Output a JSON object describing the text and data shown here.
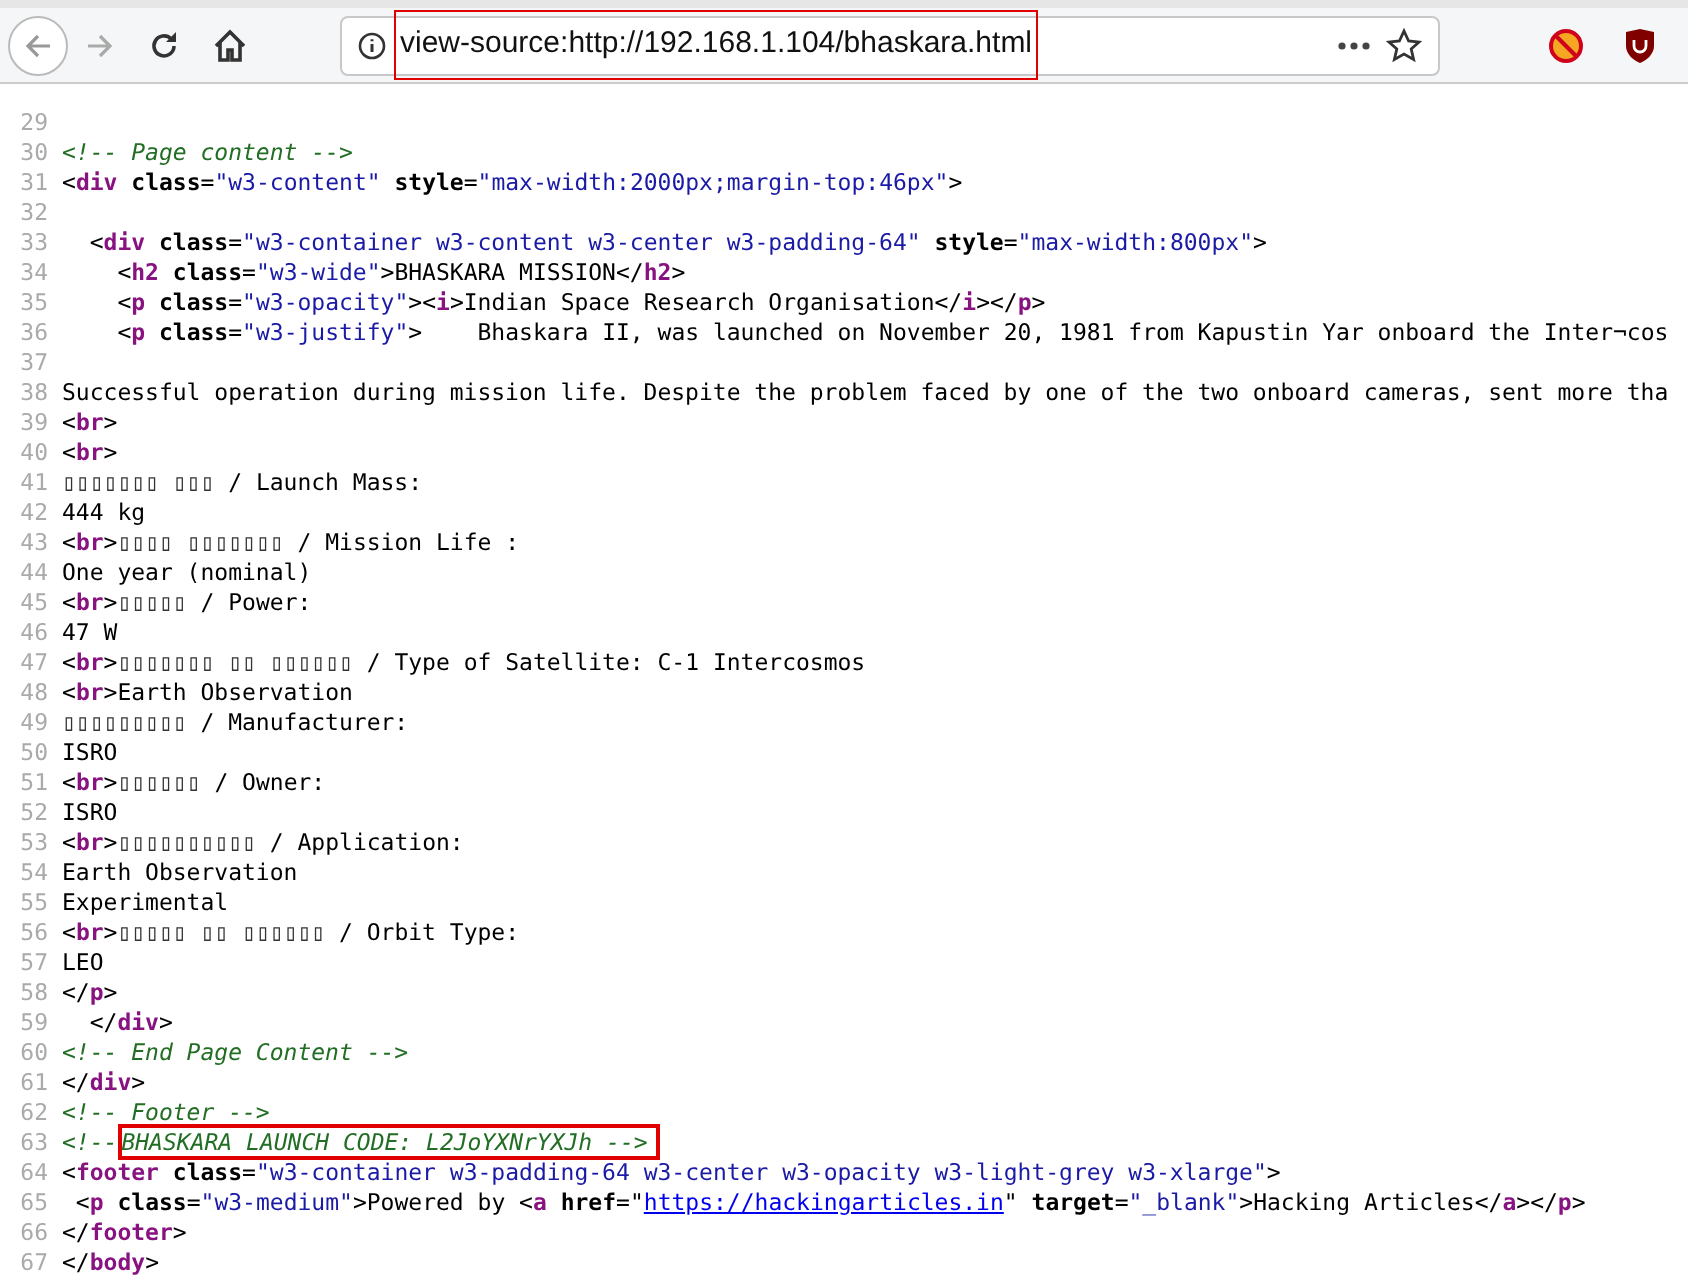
{
  "address_bar": {
    "url": "view-source:http://192.168.1.104/bhaskara.html",
    "annotated": true
  },
  "lines": [
    {
      "number": "29"
    },
    {
      "number": "30",
      "tokens": [
        {
          "kind": "comment",
          "text": "<!-- Page content -->"
        }
      ]
    },
    {
      "number": "31",
      "tokens": [
        {
          "kind": "plain",
          "text": "<"
        },
        {
          "kind": "tag",
          "text": "div"
        },
        {
          "kind": "attr",
          "text": " class"
        },
        {
          "kind": "plain",
          "text": "="
        },
        {
          "kind": "value",
          "text": "\"w3-content\""
        },
        {
          "kind": "attr",
          "text": " style"
        },
        {
          "kind": "plain",
          "text": "="
        },
        {
          "kind": "value",
          "text": "\"max-width:2000px;margin-top:46px\""
        },
        {
          "kind": "plain",
          "text": ">"
        }
      ]
    },
    {
      "number": "32"
    },
    {
      "number": "33",
      "tokens": [
        {
          "kind": "plain",
          "text": "  <"
        },
        {
          "kind": "tag",
          "text": "div"
        },
        {
          "kind": "attr",
          "text": " class"
        },
        {
          "kind": "plain",
          "text": "="
        },
        {
          "kind": "value",
          "text": "\"w3-container w3-content w3-center w3-padding-64\""
        },
        {
          "kind": "attr",
          "text": " style"
        },
        {
          "kind": "plain",
          "text": "="
        },
        {
          "kind": "value",
          "text": "\"max-width:800px\""
        },
        {
          "kind": "plain",
          "text": ">"
        }
      ]
    },
    {
      "number": "34",
      "tokens": [
        {
          "kind": "plain",
          "text": "    <"
        },
        {
          "kind": "tag",
          "text": "h2"
        },
        {
          "kind": "attr",
          "text": " class"
        },
        {
          "kind": "plain",
          "text": "="
        },
        {
          "kind": "value",
          "text": "\"w3-wide\""
        },
        {
          "kind": "plain",
          "text": ">BHASKARA MISSION</"
        },
        {
          "kind": "tag",
          "text": "h2"
        },
        {
          "kind": "plain",
          "text": ">"
        }
      ]
    },
    {
      "number": "35",
      "tokens": [
        {
          "kind": "plain",
          "text": "    <"
        },
        {
          "kind": "tag",
          "text": "p"
        },
        {
          "kind": "attr",
          "text": " class"
        },
        {
          "kind": "plain",
          "text": "="
        },
        {
          "kind": "value",
          "text": "\"w3-opacity\""
        },
        {
          "kind": "plain",
          "text": "><"
        },
        {
          "kind": "tag",
          "text": "i"
        },
        {
          "kind": "plain",
          "text": ">Indian Space Research Organisation</"
        },
        {
          "kind": "tag",
          "text": "i"
        },
        {
          "kind": "plain",
          "text": "></"
        },
        {
          "kind": "tag",
          "text": "p"
        },
        {
          "kind": "plain",
          "text": ">"
        }
      ]
    },
    {
      "number": "36",
      "tokens": [
        {
          "kind": "plain",
          "text": "    <"
        },
        {
          "kind": "tag",
          "text": "p"
        },
        {
          "kind": "attr",
          "text": " class"
        },
        {
          "kind": "plain",
          "text": "="
        },
        {
          "kind": "value",
          "text": "\"w3-justify\""
        },
        {
          "kind": "plain",
          "text": ">    Bhaskara II, was launched on November 20, 1981 from Kapustin Yar onboard the Inter¬cos"
        }
      ]
    },
    {
      "number": "37"
    },
    {
      "number": "38",
      "tokens": [
        {
          "kind": "plain",
          "text": "Successful operation during mission life. Despite the problem faced by one of the two onboard cameras, sent more tha"
        }
      ]
    },
    {
      "number": "39",
      "tokens": [
        {
          "kind": "plain",
          "text": "<"
        },
        {
          "kind": "tag",
          "text": "br"
        },
        {
          "kind": "plain",
          "text": ">"
        }
      ]
    },
    {
      "number": "40",
      "tokens": [
        {
          "kind": "plain",
          "text": "<"
        },
        {
          "kind": "tag",
          "text": "br"
        },
        {
          "kind": "plain",
          "text": ">"
        }
      ]
    },
    {
      "number": "41",
      "tokens": [
        {
          "kind": "missing",
          "text": "▯▯▯▯▯▯▯ ▯▯▯"
        },
        {
          "kind": "plain",
          "text": " / Launch Mass:"
        }
      ]
    },
    {
      "number": "42",
      "tokens": [
        {
          "kind": "plain",
          "text": "444 kg"
        }
      ]
    },
    {
      "number": "43",
      "tokens": [
        {
          "kind": "plain",
          "text": "<"
        },
        {
          "kind": "tag",
          "text": "br"
        },
        {
          "kind": "plain",
          "text": ">"
        },
        {
          "kind": "missing",
          "text": "▯▯▯▯ ▯▯▯▯▯▯▯"
        },
        {
          "kind": "plain",
          "text": " / Mission Life :"
        }
      ]
    },
    {
      "number": "44",
      "tokens": [
        {
          "kind": "plain",
          "text": "One year (nominal)"
        }
      ]
    },
    {
      "number": "45",
      "tokens": [
        {
          "kind": "plain",
          "text": "<"
        },
        {
          "kind": "tag",
          "text": "br"
        },
        {
          "kind": "plain",
          "text": ">"
        },
        {
          "kind": "missing",
          "text": "▯▯▯▯▯"
        },
        {
          "kind": "plain",
          "text": " / Power:"
        }
      ]
    },
    {
      "number": "46",
      "tokens": [
        {
          "kind": "plain",
          "text": "47 W"
        }
      ]
    },
    {
      "number": "47",
      "tokens": [
        {
          "kind": "plain",
          "text": "<"
        },
        {
          "kind": "tag",
          "text": "br"
        },
        {
          "kind": "plain",
          "text": ">"
        },
        {
          "kind": "missing",
          "text": "▯▯▯▯▯▯▯ ▯▯ ▯▯▯▯▯▯"
        },
        {
          "kind": "plain",
          "text": " / Type of Satellite: C-1 Intercosmos"
        }
      ]
    },
    {
      "number": "48",
      "tokens": [
        {
          "kind": "plain",
          "text": "<"
        },
        {
          "kind": "tag",
          "text": "br"
        },
        {
          "kind": "plain",
          "text": ">Earth Observation"
        }
      ]
    },
    {
      "number": "49",
      "tokens": [
        {
          "kind": "missing",
          "text": "▯▯▯▯▯▯▯▯▯"
        },
        {
          "kind": "plain",
          "text": " / Manufacturer:"
        }
      ]
    },
    {
      "number": "50",
      "tokens": [
        {
          "kind": "plain",
          "text": "ISRO"
        }
      ]
    },
    {
      "number": "51",
      "tokens": [
        {
          "kind": "plain",
          "text": "<"
        },
        {
          "kind": "tag",
          "text": "br"
        },
        {
          "kind": "plain",
          "text": ">"
        },
        {
          "kind": "missing",
          "text": "▯▯▯▯▯▯"
        },
        {
          "kind": "plain",
          "text": " / Owner:"
        }
      ]
    },
    {
      "number": "52",
      "tokens": [
        {
          "kind": "plain",
          "text": "ISRO"
        }
      ]
    },
    {
      "number": "53",
      "tokens": [
        {
          "kind": "plain",
          "text": "<"
        },
        {
          "kind": "tag",
          "text": "br"
        },
        {
          "kind": "plain",
          "text": ">"
        },
        {
          "kind": "missing",
          "text": "▯▯▯▯▯▯▯▯▯▯"
        },
        {
          "kind": "plain",
          "text": " / Application:"
        }
      ]
    },
    {
      "number": "54",
      "tokens": [
        {
          "kind": "plain",
          "text": "Earth Observation"
        }
      ]
    },
    {
      "number": "55",
      "tokens": [
        {
          "kind": "plain",
          "text": "Experimental"
        }
      ]
    },
    {
      "number": "56",
      "tokens": [
        {
          "kind": "plain",
          "text": "<"
        },
        {
          "kind": "tag",
          "text": "br"
        },
        {
          "kind": "plain",
          "text": ">"
        },
        {
          "kind": "missing",
          "text": "▯▯▯▯▯ ▯▯ ▯▯▯▯▯▯"
        },
        {
          "kind": "plain",
          "text": " / Orbit Type:"
        }
      ]
    },
    {
      "number": "57",
      "tokens": [
        {
          "kind": "plain",
          "text": "LEO"
        }
      ]
    },
    {
      "number": "58",
      "tokens": [
        {
          "kind": "plain",
          "text": "</"
        },
        {
          "kind": "tag",
          "text": "p"
        },
        {
          "kind": "plain",
          "text": ">"
        }
      ]
    },
    {
      "number": "59",
      "tokens": [
        {
          "kind": "plain",
          "text": "  </"
        },
        {
          "kind": "tag",
          "text": "div"
        },
        {
          "kind": "plain",
          "text": ">"
        }
      ]
    },
    {
      "number": "60",
      "tokens": [
        {
          "kind": "comment",
          "text": "<!-- End Page Content -->"
        }
      ]
    },
    {
      "number": "61",
      "tokens": [
        {
          "kind": "plain",
          "text": "</"
        },
        {
          "kind": "tag",
          "text": "div"
        },
        {
          "kind": "plain",
          "text": ">"
        }
      ]
    },
    {
      "number": "62",
      "tokens": [
        {
          "kind": "comment",
          "text": "<!-- Footer -->"
        }
      ]
    },
    {
      "number": "63",
      "tokens": [
        {
          "kind": "comment",
          "text": "<!--"
        }
      ],
      "boxed": {
        "kind": "comment",
        "text": "BHASKARA LAUNCH CODE: L2JoYXNrYXJh -->"
      }
    },
    {
      "number": "64",
      "tokens": [
        {
          "kind": "plain",
          "text": "<"
        },
        {
          "kind": "tag",
          "text": "footer"
        },
        {
          "kind": "attr",
          "text": " class"
        },
        {
          "kind": "plain",
          "text": "="
        },
        {
          "kind": "value",
          "text": "\"w3-container w3-padding-64 w3-center w3-opacity w3-light-grey w3-xlarge\""
        },
        {
          "kind": "plain",
          "text": ">"
        }
      ]
    },
    {
      "number": "65",
      "tokens": [
        {
          "kind": "plain",
          "text": " <"
        },
        {
          "kind": "tag",
          "text": "p"
        },
        {
          "kind": "attr",
          "text": " class"
        },
        {
          "kind": "plain",
          "text": "="
        },
        {
          "kind": "value",
          "text": "\"w3-medium\""
        },
        {
          "kind": "plain",
          "text": ">Powered by <"
        },
        {
          "kind": "tag",
          "text": "a"
        },
        {
          "kind": "attr",
          "text": " href"
        },
        {
          "kind": "plain",
          "text": "=\""
        },
        {
          "kind": "link",
          "text": "https://hackingarticles.in"
        },
        {
          "kind": "plain",
          "text": "\""
        },
        {
          "kind": "attr",
          "text": " target"
        },
        {
          "kind": "plain",
          "text": "="
        },
        {
          "kind": "value",
          "text": "\"_blank\""
        },
        {
          "kind": "plain",
          "text": ">Hacking Articles</"
        },
        {
          "kind": "tag",
          "text": "a"
        },
        {
          "kind": "plain",
          "text": "></"
        },
        {
          "kind": "tag",
          "text": "p"
        },
        {
          "kind": "plain",
          "text": ">"
        }
      ]
    },
    {
      "number": "66",
      "tokens": [
        {
          "kind": "plain",
          "text": "</"
        },
        {
          "kind": "tag",
          "text": "footer"
        },
        {
          "kind": "plain",
          "text": ">"
        }
      ]
    },
    {
      "number": "67",
      "tokens": [
        {
          "kind": "plain",
          "text": "</"
        },
        {
          "kind": "tag",
          "text": "body"
        },
        {
          "kind": "plain",
          "text": ">"
        }
      ]
    }
  ]
}
